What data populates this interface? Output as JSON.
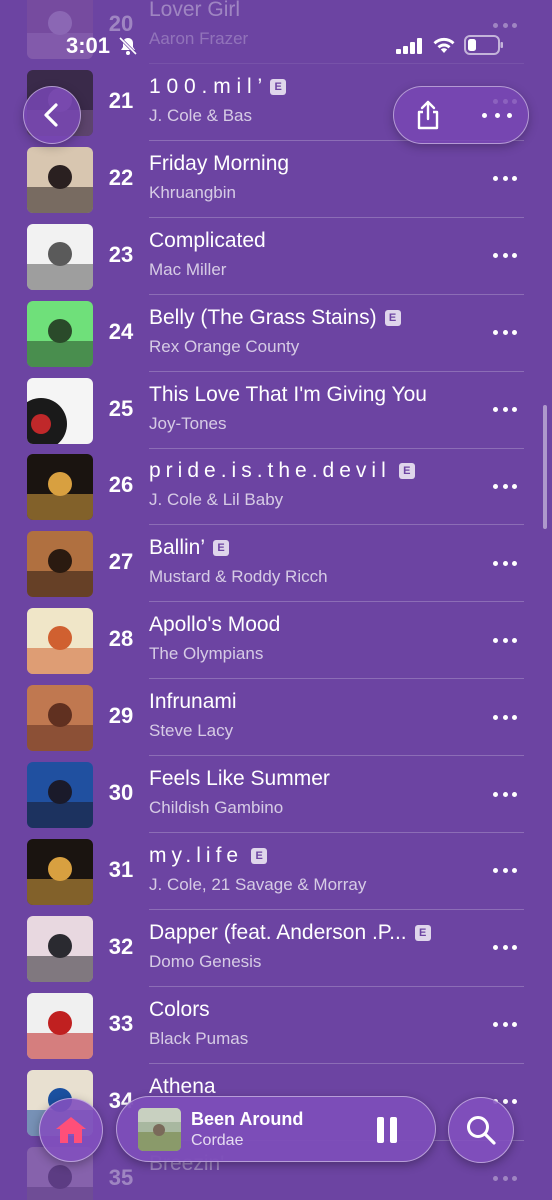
{
  "status": {
    "time": "3:01"
  },
  "tracks": [
    {
      "num": "20",
      "title": "Lover Girl",
      "artist": "Aaron Frazer",
      "explicit": false,
      "spaced": false
    },
    {
      "num": "21",
      "title": "1 0 0 . m i l ’",
      "artist": "J. Cole & Bas",
      "explicit": true,
      "spaced": false
    },
    {
      "num": "22",
      "title": "Friday Morning",
      "artist": "Khruangbin",
      "explicit": false,
      "spaced": false
    },
    {
      "num": "23",
      "title": "Complicated",
      "artist": "Mac Miller",
      "explicit": false,
      "spaced": false
    },
    {
      "num": "24",
      "title": "Belly (The Grass Stains)",
      "artist": "Rex Orange County",
      "explicit": true,
      "spaced": false
    },
    {
      "num": "25",
      "title": "This Love That I'm Giving You",
      "artist": "Joy-Tones",
      "explicit": false,
      "spaced": false
    },
    {
      "num": "26",
      "title": "pride.is.the.devil",
      "artist": "J. Cole & Lil Baby",
      "explicit": true,
      "spaced": true
    },
    {
      "num": "27",
      "title": "Ballin’",
      "artist": "Mustard & Roddy Ricch",
      "explicit": true,
      "spaced": false
    },
    {
      "num": "28",
      "title": "Apollo's Mood",
      "artist": "The Olympians",
      "explicit": false,
      "spaced": false
    },
    {
      "num": "29",
      "title": "Infrunami",
      "artist": "Steve Lacy",
      "explicit": false,
      "spaced": false
    },
    {
      "num": "30",
      "title": "Feels Like Summer",
      "artist": "Childish Gambino",
      "explicit": false,
      "spaced": false
    },
    {
      "num": "31",
      "title": "my.life",
      "artist": "J. Cole, 21 Savage & Morray",
      "explicit": true,
      "spaced": true
    },
    {
      "num": "32",
      "title": "Dapper (feat. Anderson .P...",
      "artist": "Domo Genesis",
      "explicit": true,
      "spaced": false
    },
    {
      "num": "33",
      "title": "Colors",
      "artist": "Black Pumas",
      "explicit": false,
      "spaced": false
    },
    {
      "num": "34",
      "title": "Athena",
      "artist": "",
      "explicit": false,
      "spaced": false
    },
    {
      "num": "35",
      "title": "Breezin'",
      "artist": "",
      "explicit": false,
      "spaced": false
    }
  ],
  "explicit_badge": "E",
  "album_art": {
    "20": {
      "bg": "#8a5a9a",
      "fg": "#c7a9d8"
    },
    "21": {
      "bg": "#3a2a4a",
      "fg": "#7a5a8a"
    },
    "22": {
      "bg": "#d8c6b0",
      "fg": "#2a2020"
    },
    "23": {
      "bg": "#f2f2f2",
      "fg": "#5a5a5a"
    },
    "24": {
      "bg": "#6fe07a",
      "fg": "#2a4a2a"
    },
    "25": {
      "bg": "#f5f5f5",
      "fg": "#1a1a1a",
      "accent": "#c0282a"
    },
    "26": {
      "bg": "#1a1410",
      "fg": "#d8a040"
    },
    "27": {
      "bg": "#b07040",
      "fg": "#2a1a10"
    },
    "28": {
      "bg": "#f0e6c8",
      "fg": "#d06030"
    },
    "29": {
      "bg": "#c07850",
      "fg": "#603020"
    },
    "30": {
      "bg": "#2050a0",
      "fg": "#1a1a2a"
    },
    "31": {
      "bg": "#1a1410",
      "fg": "#d8a040"
    },
    "32": {
      "bg": "#e8d8e0",
      "fg": "#2a2a30"
    },
    "33": {
      "bg": "#f0f0f0",
      "fg": "#c02020"
    },
    "34": {
      "bg": "#e8e0d0",
      "fg": "#1a50a0"
    },
    "35": {
      "bg": "#b89ac0",
      "fg": "#40304a"
    }
  },
  "now_playing": {
    "title": "Been Around",
    "artist": "Cordae"
  },
  "colors": {
    "background": "#6c44a2",
    "home_icon": "#ff4f79"
  }
}
